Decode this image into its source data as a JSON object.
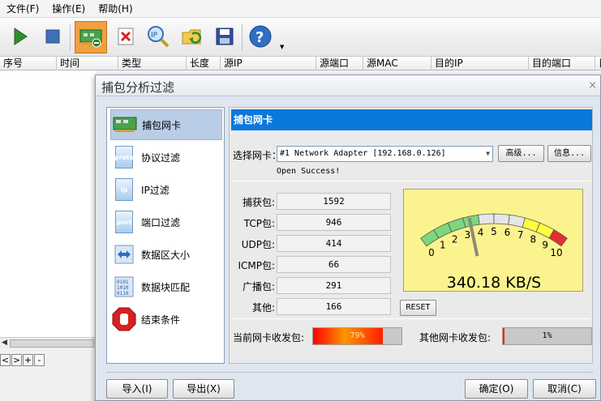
{
  "menu": [
    "文件(F)",
    "操作(E)",
    "帮助(H)"
  ],
  "toolbar_icons": [
    "play-icon",
    "stop-icon",
    "adapter-icon",
    "clear-icon",
    "ip-search-icon",
    "open-icon",
    "save-icon",
    "help-icon"
  ],
  "columns": [
    "序号",
    "时间",
    "类型",
    "长度",
    "源IP",
    "源端口",
    "源MAC",
    "目的IP",
    "目的端口",
    "目"
  ],
  "nav_buttons": [
    "<",
    ">",
    "+",
    "-"
  ],
  "dialog": {
    "title": "捕包分析过滤",
    "close": "×",
    "nav": [
      {
        "label": "捕包网卡",
        "icon": "network-card-icon"
      },
      {
        "label": "协议过滤",
        "icon_text": "proto"
      },
      {
        "label": "IP过滤",
        "icon_text": "ip"
      },
      {
        "label": "端口过滤",
        "icon_text": "port"
      },
      {
        "label": "数据区大小",
        "icon": "resize-icon"
      },
      {
        "label": "数据块匹配",
        "icon": "binary-icon"
      },
      {
        "label": "结束条件",
        "icon": "stop-hand-icon"
      }
    ],
    "header": "捕包网卡",
    "select_label": "选择网卡：",
    "select_value": "#1 Network Adapter [192.168.0.126]",
    "advanced_btn": "高级...",
    "info_btn": "信息...",
    "open_status": "Open Success!",
    "stats": [
      {
        "label": "捕获包:",
        "value": "1592"
      },
      {
        "label": "TCP包:",
        "value": "946"
      },
      {
        "label": "UDP包:",
        "value": "414"
      },
      {
        "label": "ICMP包:",
        "value": "66"
      },
      {
        "label": "广播包:",
        "value": "291"
      },
      {
        "label": "其他:",
        "value": "166"
      }
    ],
    "gauge": {
      "ticks": [
        "0",
        "1",
        "2",
        "3",
        "4",
        "5",
        "6",
        "7",
        "8",
        "9",
        "10"
      ],
      "readout": "340.18 KB/S",
      "needle_value": 3.4
    },
    "reset_btn": "RESET",
    "current_label": "当前网卡收发包:",
    "current_value": "79%",
    "current_fraction": 0.79,
    "other_label": "其他网卡收发包:",
    "other_value": "1%",
    "other_fraction": 0.01,
    "import_btn": "导入(I)",
    "export_btn": "导出(X)",
    "ok_btn": "确定(O)",
    "cancel_btn": "取消(C)"
  }
}
